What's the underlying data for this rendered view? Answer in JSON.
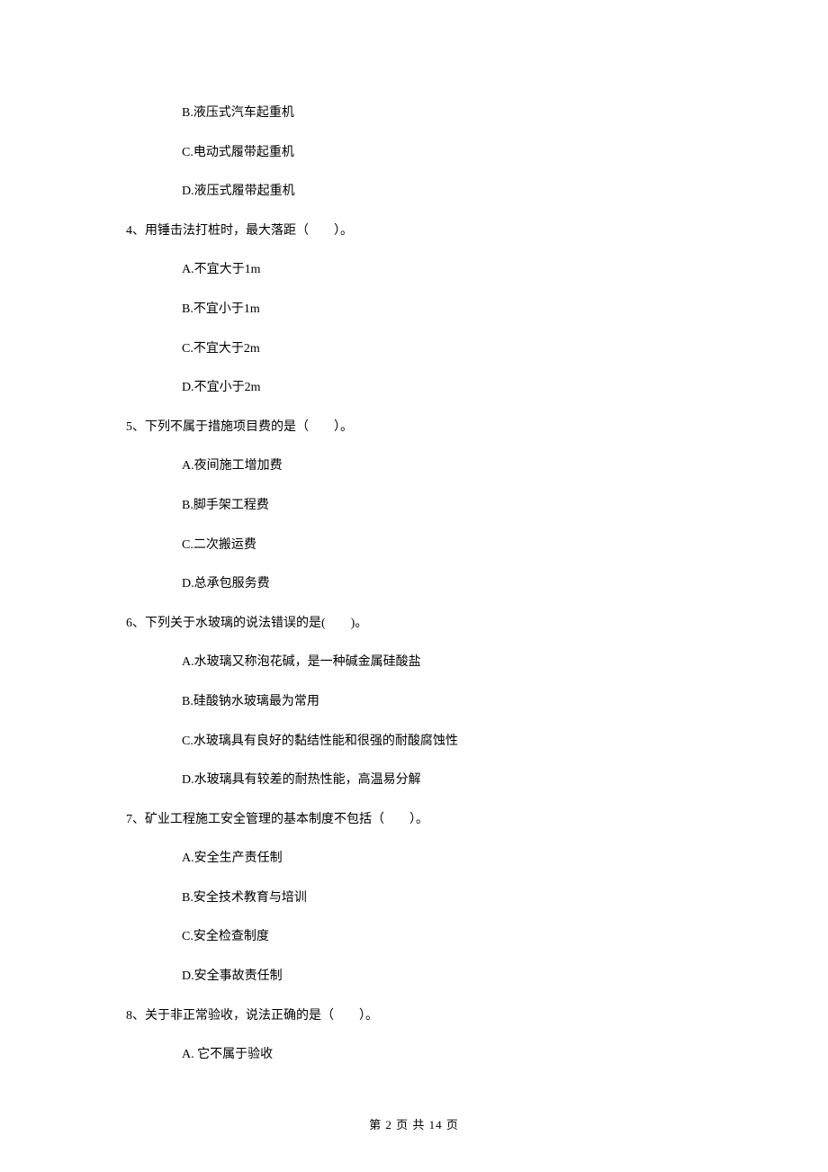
{
  "q3_remaining_options": {
    "b": "B.液压式汽车起重机",
    "c": "C.电动式履带起重机",
    "d": "D.液压式履带起重机"
  },
  "q4": {
    "stem": "4、用锤击法打桩时，最大落距（　　）。",
    "a": "A.不宜大于1m",
    "b": "B.不宜小于1m",
    "c": "C.不宜大于2m",
    "d": "D.不宜小于2m"
  },
  "q5": {
    "stem": "5、下列不属于措施项目费的是（　　）。",
    "a": "A.夜间施工增加费",
    "b": "B.脚手架工程费",
    "c": "C.二次搬运费",
    "d": "D.总承包服务费"
  },
  "q6": {
    "stem": "6、下列关于水玻璃的说法错误的是(　　)。",
    "a": "A.水玻璃又称泡花碱，是一种碱金属硅酸盐",
    "b": "B.硅酸钠水玻璃最为常用",
    "c": "C.水玻璃具有良好的黏结性能和很强的耐酸腐蚀性",
    "d": "D.水玻璃具有较差的耐热性能，高温易分解"
  },
  "q7": {
    "stem": "7、矿业工程施工安全管理的基本制度不包括（　　）。",
    "a": "A.安全生产责任制",
    "b": "B.安全技术教育与培训",
    "c": "C.安全检查制度",
    "d": "D.安全事故责任制"
  },
  "q8": {
    "stem": "8、关于非正常验收，说法正确的是（　　）。",
    "a": "A. 它不属于验收"
  },
  "footer": "第 2 页 共 14 页"
}
